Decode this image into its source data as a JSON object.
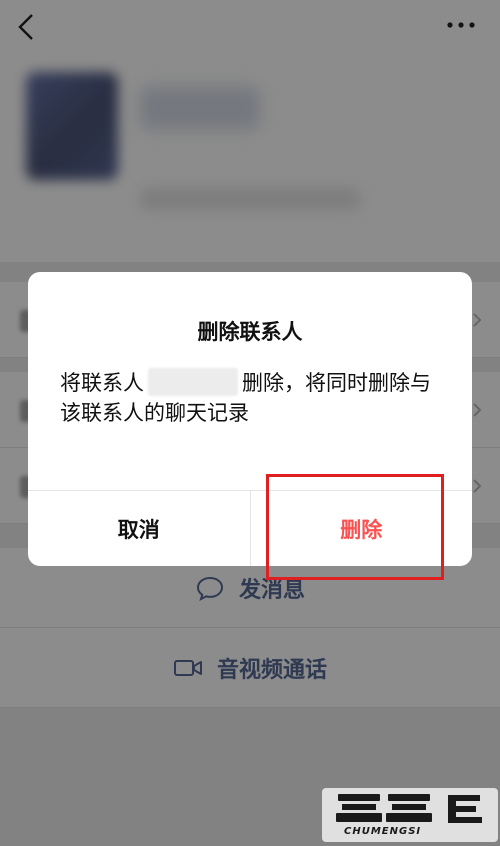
{
  "dialog": {
    "title": "删除联系人",
    "message_before": "将联系人",
    "message_after": "删除，将同时删除与该联系人的聊天记录",
    "cancel_label": "取消",
    "confirm_label": "删除"
  },
  "actions": {
    "message_label": "发消息",
    "call_label": "音视频通话"
  },
  "watermark": {
    "text": "CHUMENGSI"
  },
  "colors": {
    "confirm": "#fa5151",
    "link": "#576b95",
    "highlight": "#e02020"
  }
}
